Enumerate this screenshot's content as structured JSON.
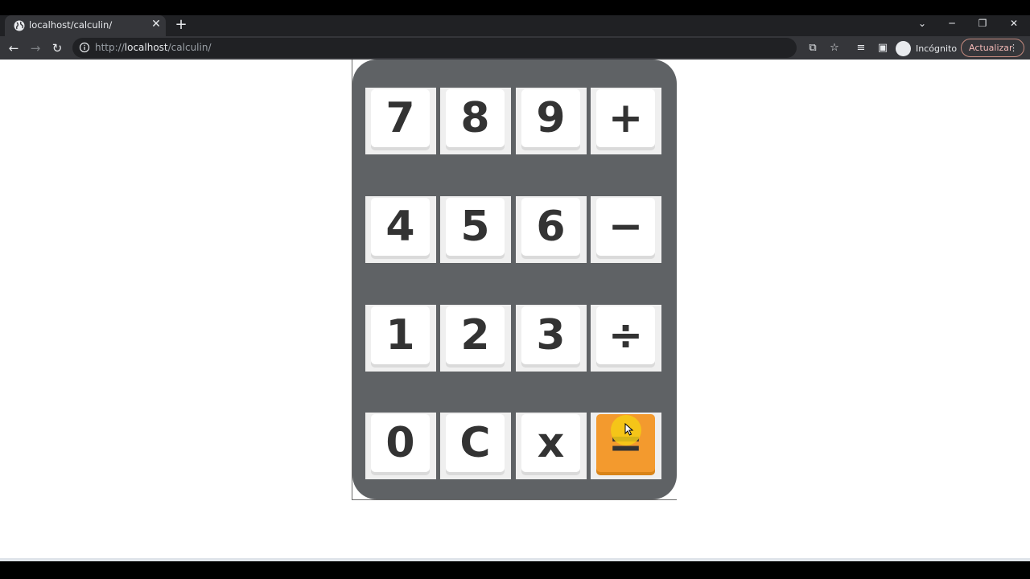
{
  "browser": {
    "tab_title": "localhost/calculin/",
    "tab_close": "✕",
    "new_tab": "+",
    "url_prefix": "http://",
    "url_host": "localhost",
    "url_path": "/calculin/",
    "incognito_label": "Incógnito",
    "update_label": "Actualizar"
  },
  "calculator": {
    "rows": [
      [
        "7",
        "8",
        "9",
        "+"
      ],
      [
        "4",
        "5",
        "6",
        "−"
      ],
      [
        "1",
        "2",
        "3",
        "÷"
      ],
      [
        "0",
        "C",
        "x",
        "="
      ]
    ]
  },
  "colors": {
    "calculator_body": "#5f6265",
    "key_face": "#ffffff",
    "equals_key": "#f39a2e",
    "cursor_highlight": "#f5cd14"
  }
}
